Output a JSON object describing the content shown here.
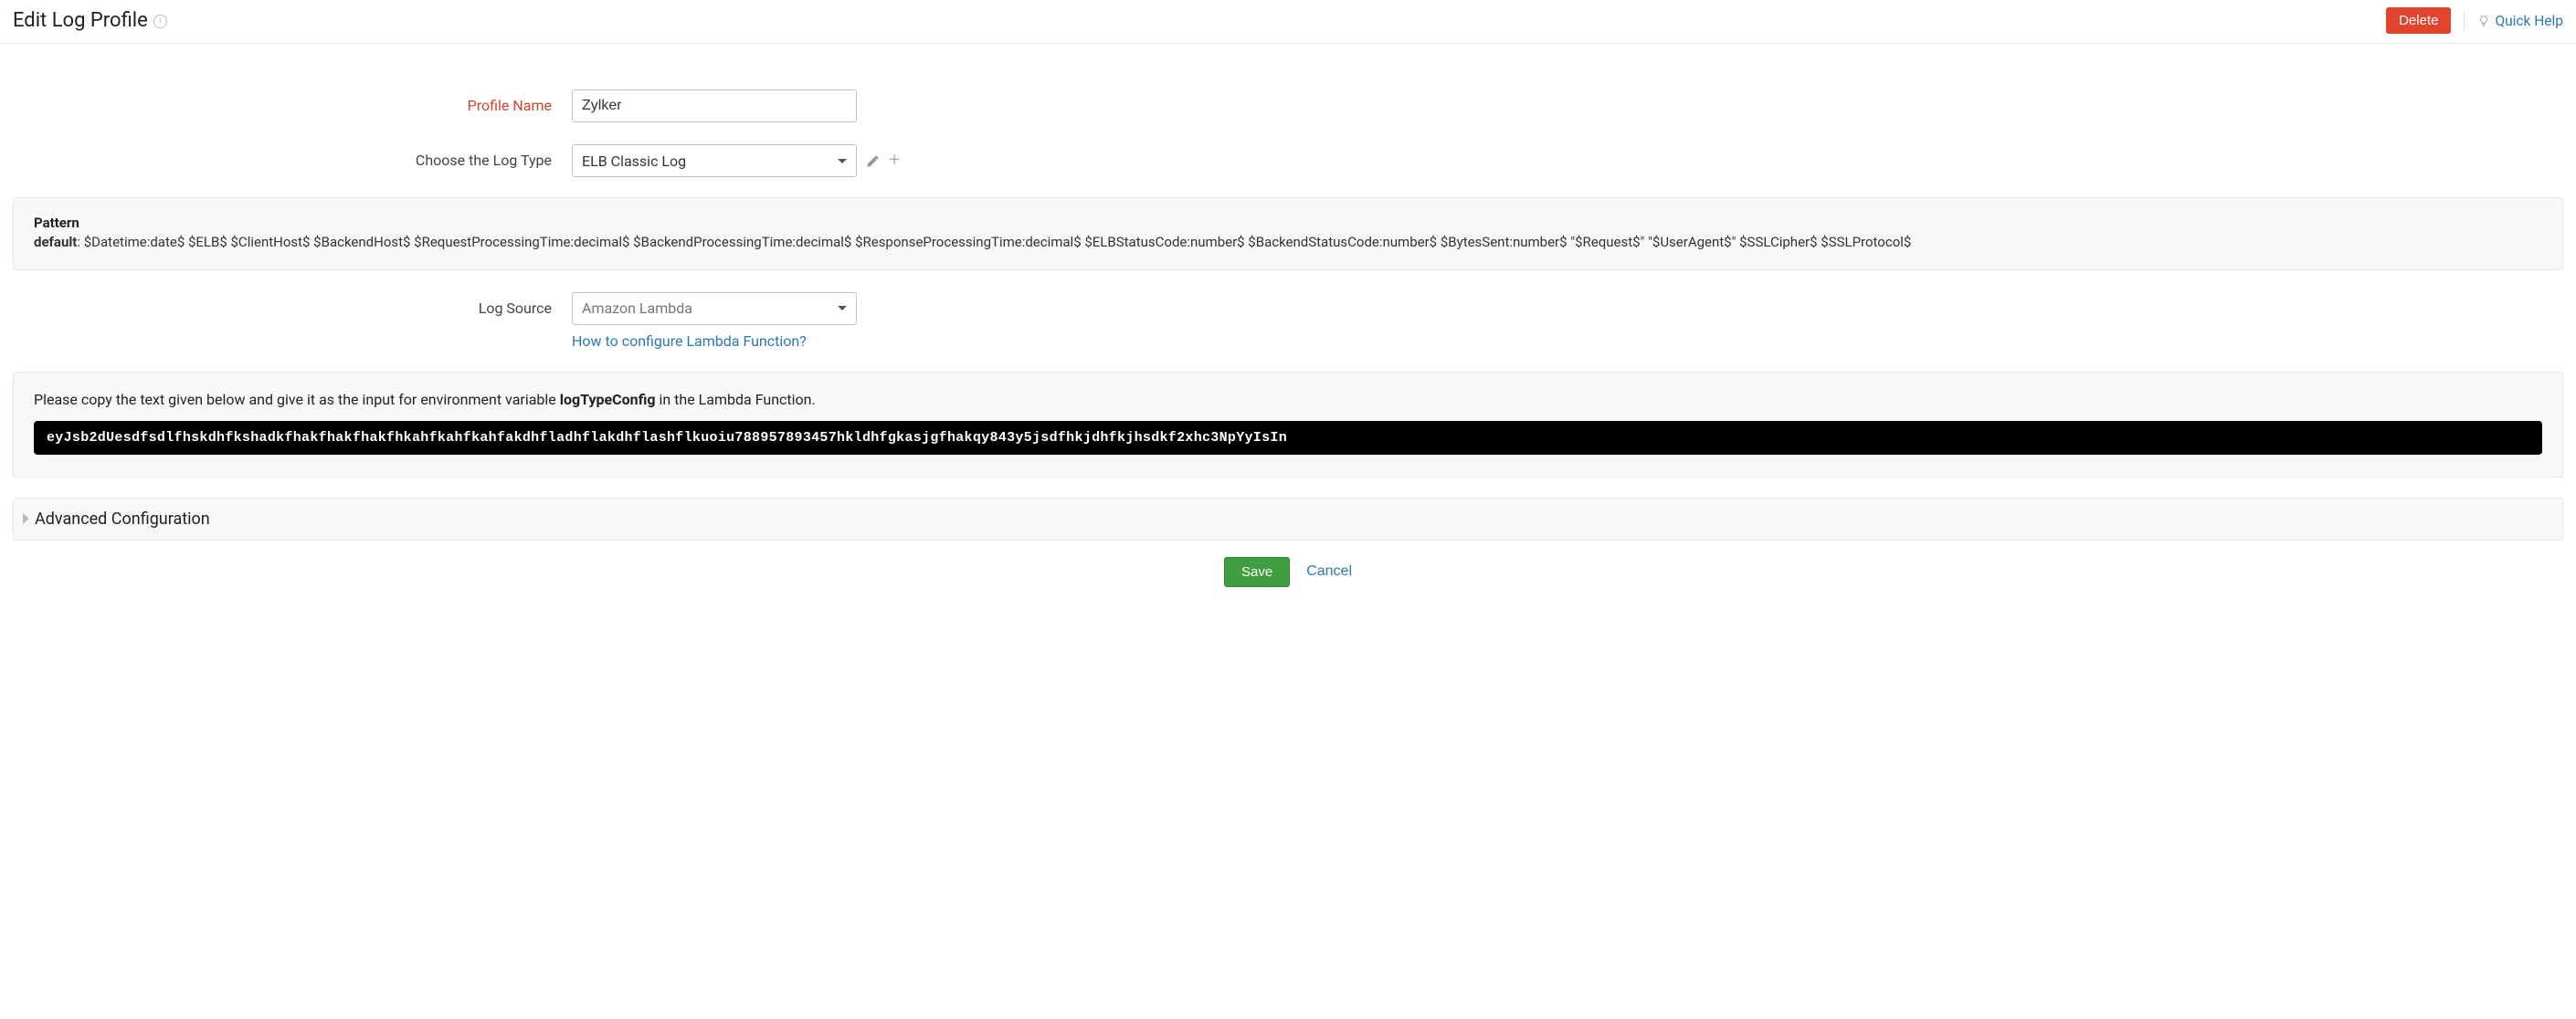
{
  "header": {
    "title": "Edit Log Profile",
    "delete_label": "Delete",
    "quick_help_label": "Quick Help"
  },
  "form": {
    "profile_name_label": "Profile Name",
    "profile_name_value": "Zylker",
    "log_type_label": "Choose the Log Type",
    "log_type_value": "ELB Classic Log",
    "log_source_label": "Log Source",
    "log_source_value": "Amazon Lambda",
    "lambda_help_link": "How to configure Lambda Function?"
  },
  "pattern": {
    "heading": "Pattern",
    "prefix": "default",
    "body": ": $Datetime:date$ $ELB$ $ClientHost$ $BackendHost$ $RequestProcessingTime:decimal$ $BackendProcessingTime:decimal$ $ResponseProcessingTime:decimal$ $ELBStatusCode:number$ $BackendStatusCode:number$ $BytesSent:number$ \"$Request$\" \"$UserAgent$\" $SSLCipher$ $SSLProtocol$"
  },
  "copy_panel": {
    "instruction_pre": "Please copy the text given below and give it as the input for environment variable ",
    "instruction_bold": "logTypeConfig",
    "instruction_post": " in the Lambda Function.",
    "code": "eyJsb2dUesdfsdlfhskdhfkshadkfhakfhakfhakfhkahfkahfkahfakdhfladhflakdhflashflkuoiu788957893457hkldhfgkasjgfhakqy843y5jsdfhkjdhfkjhsdkf2xhc3NpYyIsIn"
  },
  "advanced": {
    "title": "Advanced Configuration"
  },
  "footer": {
    "save_label": "Save",
    "cancel_label": "Cancel"
  }
}
